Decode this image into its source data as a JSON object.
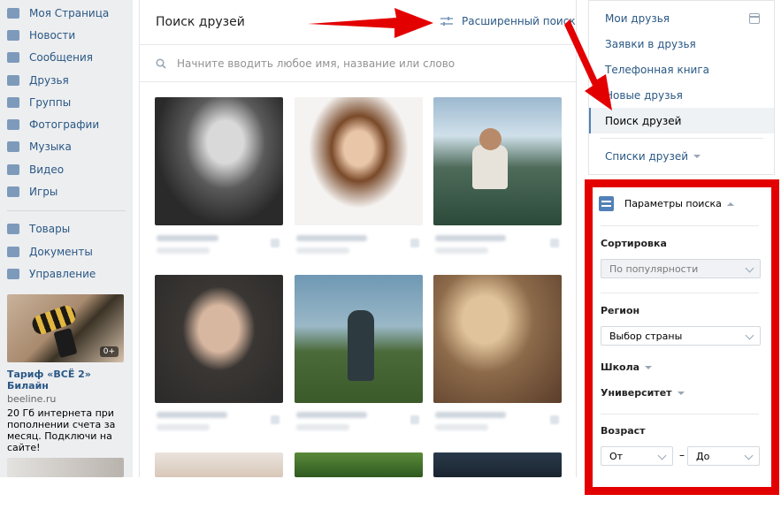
{
  "nav": {
    "items": [
      {
        "label": "Моя Страница",
        "icon": "home-icon"
      },
      {
        "label": "Новости",
        "icon": "news-icon"
      },
      {
        "label": "Сообщения",
        "icon": "messages-icon"
      },
      {
        "label": "Друзья",
        "icon": "friends-icon"
      },
      {
        "label": "Группы",
        "icon": "groups-icon"
      },
      {
        "label": "Фотографии",
        "icon": "camera-icon"
      },
      {
        "label": "Музыка",
        "icon": "music-icon"
      },
      {
        "label": "Видео",
        "icon": "video-icon"
      },
      {
        "label": "Игры",
        "icon": "games-icon"
      }
    ],
    "items2": [
      {
        "label": "Товары",
        "icon": "goods-icon"
      },
      {
        "label": "Документы",
        "icon": "documents-icon"
      },
      {
        "label": "Управление",
        "icon": "manage-icon"
      }
    ]
  },
  "ad": {
    "badge": "0+",
    "title": "Тариф «ВСЁ 2» Билайн",
    "domain": "beeline.ru",
    "text": "20 Гб интернета при пополнении счета за месяц. Подключи на сайте!"
  },
  "main": {
    "title": "Поиск друзей",
    "advanced_search": "Расширенный поиск",
    "search_placeholder": "Начните вводить любое имя, название или слово"
  },
  "right_menu": {
    "items": [
      "Мои друзья",
      "Заявки в друзья",
      "Телефонная книга",
      "Новые друзья",
      "Поиск друзей"
    ],
    "lists": "Списки друзей",
    "active_index": 4
  },
  "params": {
    "header": "Параметры поиска",
    "sort_label": "Сортировка",
    "sort_value": "По популярности",
    "region_label": "Регион",
    "region_value": "Выбор страны",
    "school_label": "Школа",
    "university_label": "Университет",
    "age_label": "Возраст",
    "age_from": "От",
    "age_dash": "–",
    "age_to": "До"
  },
  "colors": {
    "accent": "#5181b8",
    "link": "#2a5885",
    "highlight_border": "#e30000",
    "arrow": "#e30000"
  }
}
